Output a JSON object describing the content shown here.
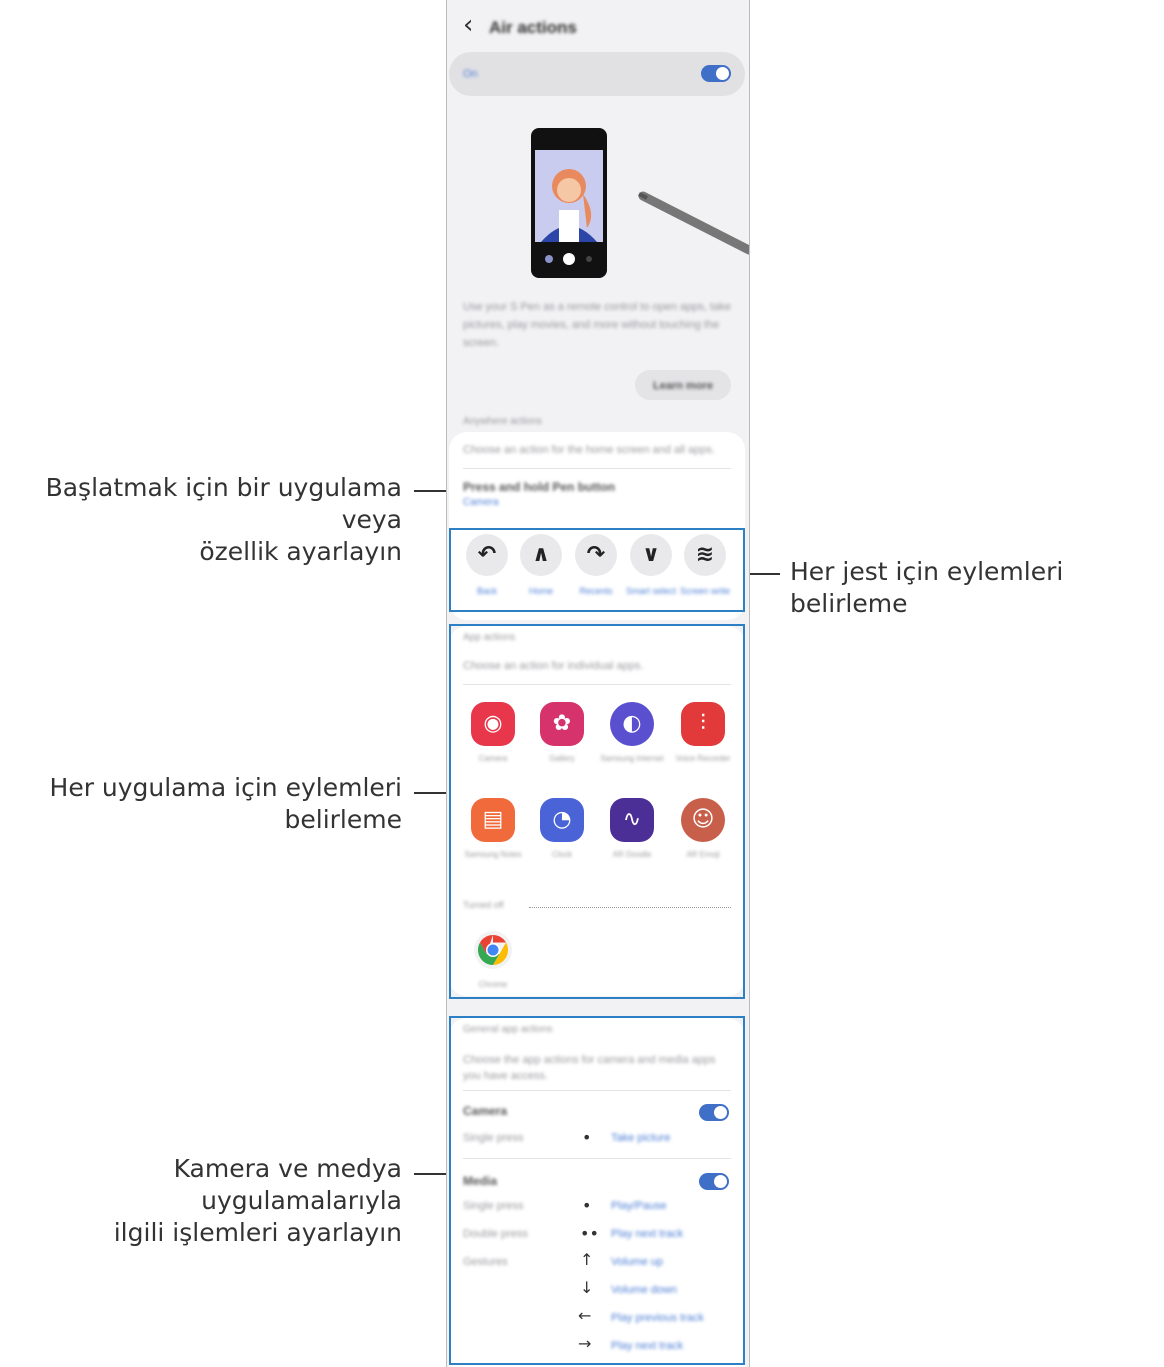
{
  "header": {
    "back_icon": "‹",
    "title": "Air actions"
  },
  "master_switch": {
    "label": "On",
    "state": "on"
  },
  "description": "Use your S Pen as a remote control to open apps, take pictures, play movies, and more without touching the screen.",
  "learn_more_label": "Learn more",
  "anywhere_section": {
    "header": "Anywhere actions",
    "intro": "Choose an action for the home screen and all apps.",
    "press_hold_title": "Press and hold Pen button",
    "press_hold_value": "Camera",
    "gestures": [
      {
        "icon": "swipe-back-icon",
        "glyph": "↶",
        "label": "Back"
      },
      {
        "icon": "swipe-home-icon",
        "glyph": "∧",
        "label": "Home"
      },
      {
        "icon": "swipe-recents-icon",
        "glyph": "↷",
        "label": "Recents"
      },
      {
        "icon": "smart-select-icon",
        "glyph": "∨",
        "label": "Smart select"
      },
      {
        "icon": "screen-write-icon",
        "glyph": "≋",
        "label": "Screen write"
      }
    ]
  },
  "app_section": {
    "header": "App actions",
    "intro": "Choose an action for individual apps.",
    "apps": [
      {
        "icon": "camera-app-icon",
        "glyph": "◉",
        "color": "#e8374a",
        "label": "Camera"
      },
      {
        "icon": "gallery-app-icon",
        "glyph": "✿",
        "color": "#d6336c",
        "label": "Gallery"
      },
      {
        "icon": "internet-app-icon",
        "glyph": "◐",
        "color": "#5a4fcf",
        "label": "Samsung Internet"
      },
      {
        "icon": "voice-recorder-app-icon",
        "glyph": "⫶",
        "color": "#e23a3a",
        "label": "Voice Recorder"
      },
      {
        "icon": "notes-app-icon",
        "glyph": "▤",
        "color": "#f06a3c",
        "label": "Samsung Notes"
      },
      {
        "icon": "clock-app-icon",
        "glyph": "◔",
        "color": "#4a64d8",
        "label": "Clock"
      },
      {
        "icon": "ar-doodle-app-icon",
        "glyph": "∿",
        "color": "#4b2f96",
        "label": "AR Doodle"
      },
      {
        "icon": "ar-emoji-app-icon",
        "glyph": "☺",
        "color": "#c85f4a",
        "label": "AR Emoji"
      }
    ],
    "turned_off_label": "Turned off",
    "off_apps": [
      {
        "icon": "chrome-app-icon",
        "label": "Chrome"
      }
    ]
  },
  "general_section": {
    "header": "General app actions",
    "intro": "Choose the app actions for camera and media apps you have access.",
    "camera": {
      "title": "Camera",
      "toggle": "on",
      "rows": [
        {
          "gesture": "Single press",
          "symbol": "•",
          "action": "Take picture"
        }
      ]
    },
    "media": {
      "title": "Media",
      "toggle": "on",
      "rows": [
        {
          "gesture": "Single press",
          "symbol": "•",
          "action": "Play/Pause"
        },
        {
          "gesture": "Double press",
          "symbol": "••",
          "action": "Play next track"
        },
        {
          "gesture": "Gestures",
          "symbol": "↑",
          "action": "Volume up"
        },
        {
          "gesture": "",
          "symbol": "↓",
          "action": "Volume down"
        },
        {
          "gesture": "",
          "symbol": "←",
          "action": "Play previous track"
        },
        {
          "gesture": "",
          "symbol": "→",
          "action": "Play next track"
        }
      ]
    }
  },
  "callouts": {
    "start_app": [
      "Başlatmak için bir uygulama veya",
      "özellik ayarlayın"
    ],
    "gesture_actions": [
      "Her jest için eylemleri belirleme"
    ],
    "app_actions": [
      "Her uygulama için eylemleri",
      "belirleme"
    ],
    "media_actions": [
      "Kamera ve medya uygulamalarıyla",
      "ilgili işlemleri ayarlayın"
    ]
  },
  "colors": {
    "accent": "#3f6fc7",
    "frame": "#2e80c4"
  }
}
